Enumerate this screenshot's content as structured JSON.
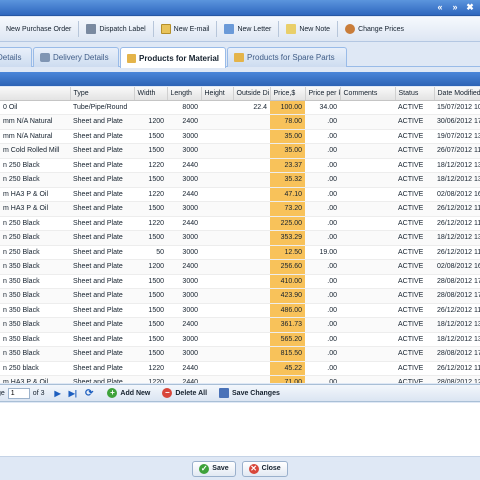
{
  "window": {
    "controls": [
      "«",
      "»",
      "✖"
    ]
  },
  "toolbar": {
    "buttons": [
      {
        "label": "New Purchase Order",
        "icon": "purchase-order-icon",
        "color": "#5c8ed6"
      },
      {
        "label": "Dispatch Label",
        "icon": "printer-icon",
        "color": "#7a8aa0"
      },
      {
        "label": "New E-mail",
        "icon": "email-icon",
        "color": "#e8c35a"
      },
      {
        "label": "New Letter",
        "icon": "letter-icon",
        "color": "#6b9ad8"
      },
      {
        "label": "New Note",
        "icon": "note-icon",
        "color": "#e9cf6a"
      },
      {
        "label": "Change Prices",
        "icon": "change-prices-icon",
        "color": "#c97d3a"
      }
    ]
  },
  "tabs": [
    {
      "label": "Details",
      "icon": ""
    },
    {
      "label": "Delivery Details",
      "icon": "truck-icon"
    },
    {
      "label": "Products for Material",
      "icon": "box-icon"
    },
    {
      "label": "Products for Spare Parts",
      "icon": "box-icon"
    }
  ],
  "grid": {
    "columns": [
      "",
      "Type",
      "Width",
      "Length",
      "Height",
      "Outside Di",
      "Price,$",
      "Price per ki",
      "Comments",
      "Status",
      "Date Modified"
    ],
    "rows": [
      [
        "0 Oil",
        "Tube/Pipe/Round",
        "",
        "8000",
        "",
        "22.4",
        "100.00",
        "34.00",
        "",
        "ACTIVE",
        "15/07/2012 10"
      ],
      [
        "mm N/A Natural",
        "Sheet and Plate",
        "1200",
        "2400",
        "",
        "",
        "78.00",
        ".00",
        "",
        "ACTIVE",
        "30/06/2012 17"
      ],
      [
        "mm N/A Natural",
        "Sheet and Plate",
        "1500",
        "3000",
        "",
        "",
        "35.00",
        ".00",
        "",
        "ACTIVE",
        "19/07/2012 13"
      ],
      [
        "m Cold Rolled Mill",
        "Sheet and Plate",
        "1500",
        "3000",
        "",
        "",
        "35.00",
        ".00",
        "",
        "ACTIVE",
        "26/07/2012 11"
      ],
      [
        "n 250 Black",
        "Sheet and Plate",
        "1220",
        "2440",
        "",
        "",
        "23.37",
        ".00",
        "",
        "ACTIVE",
        "18/12/2012 13"
      ],
      [
        "n 250 Black",
        "Sheet and Plate",
        "1500",
        "3000",
        "",
        "",
        "35.32",
        ".00",
        "",
        "ACTIVE",
        "18/12/2012 13"
      ],
      [
        "m HA3 P & Oil",
        "Sheet and Plate",
        "1220",
        "2440",
        "",
        "",
        "47.10",
        ".00",
        "",
        "ACTIVE",
        "02/08/2012 16"
      ],
      [
        "m HA3 P & Oil",
        "Sheet and Plate",
        "1500",
        "3000",
        "",
        "",
        "73.20",
        ".00",
        "",
        "ACTIVE",
        "26/12/2012 11"
      ],
      [
        "n 250 Black",
        "Sheet and Plate",
        "1220",
        "2440",
        "",
        "",
        "225.00",
        ".00",
        "",
        "ACTIVE",
        "26/12/2012 11"
      ],
      [
        "n 250 Black",
        "Sheet and Plate",
        "1500",
        "3000",
        "",
        "",
        "353.29",
        ".00",
        "",
        "ACTIVE",
        "18/12/2012 13"
      ],
      [
        "n 250 Black",
        "Sheet and Plate",
        "50",
        "3000",
        "",
        "",
        "12.50",
        "19.00",
        "",
        "ACTIVE",
        "26/12/2012 11"
      ],
      [
        "n 350 Black",
        "Sheet and Plate",
        "1200",
        "2400",
        "",
        "",
        "256.60",
        ".00",
        "",
        "ACTIVE",
        "02/08/2012 16"
      ],
      [
        "n 350 Black",
        "Sheet and Plate",
        "1500",
        "3000",
        "",
        "",
        "410.00",
        ".00",
        "",
        "ACTIVE",
        "28/08/2012 17"
      ],
      [
        "n 350 Black",
        "Sheet and Plate",
        "1500",
        "3000",
        "",
        "",
        "423.90",
        ".00",
        "",
        "ACTIVE",
        "28/08/2012 17"
      ],
      [
        "n 350 Black",
        "Sheet and Plate",
        "1500",
        "3000",
        "",
        "",
        "486.00",
        ".00",
        "",
        "ACTIVE",
        "26/12/2012 11"
      ],
      [
        "n 350 Black",
        "Sheet and Plate",
        "1500",
        "2400",
        "",
        "",
        "361.73",
        ".00",
        "",
        "ACTIVE",
        "18/12/2012 13"
      ],
      [
        "n 350 Black",
        "Sheet and Plate",
        "1500",
        "3000",
        "",
        "",
        "565.20",
        ".00",
        "",
        "ACTIVE",
        "18/12/2012 13"
      ],
      [
        "n 350 Black",
        "Sheet and Plate",
        "1500",
        "3000",
        "",
        "",
        "815.50",
        ".00",
        "",
        "ACTIVE",
        "28/08/2012 17"
      ],
      [
        "n 250 black",
        "Sheet and Plate",
        "1220",
        "2440",
        "",
        "",
        "45.22",
        ".00",
        "",
        "ACTIVE",
        "26/12/2012 11"
      ],
      [
        "m HA3 P & Oil",
        "Sheet and Plate",
        "1220",
        "2440",
        "",
        "",
        "71.00",
        ".00",
        "",
        "ACTIVE",
        "28/08/2012 12"
      ]
    ]
  },
  "paging": {
    "page_label": "ge",
    "current_page": "1",
    "of_label": "of 3",
    "add_new_label": "Add New",
    "delete_all_label": "Delete All",
    "save_changes_label": "Save Changes"
  },
  "footer": {
    "save_label": "Save",
    "close_label": "Close"
  },
  "colors": {
    "price_highlight": "#f8c25a",
    "header_blue": "#3a74c9"
  }
}
